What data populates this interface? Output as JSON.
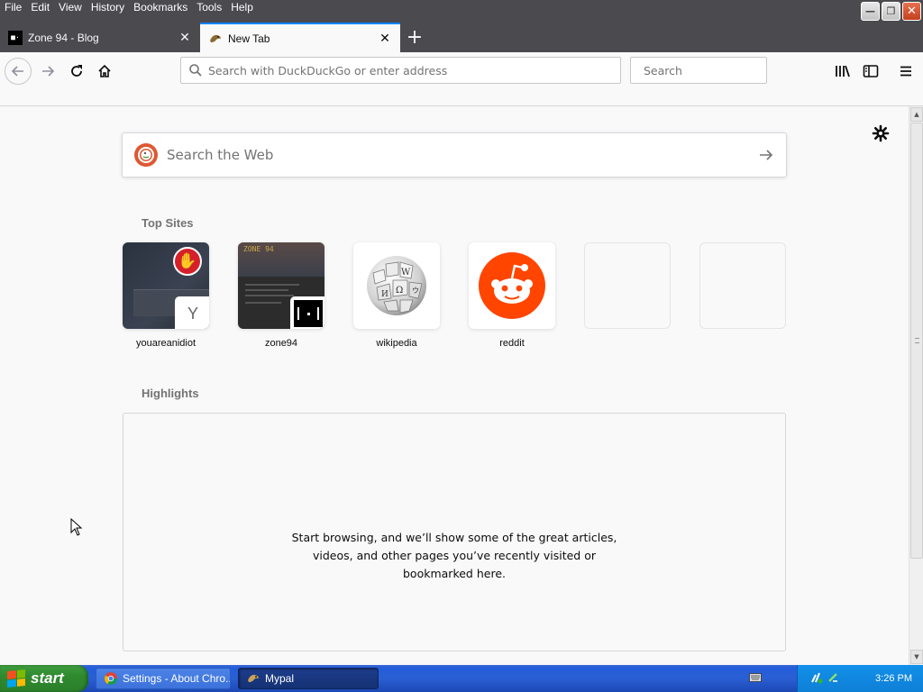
{
  "menu": {
    "items": [
      "File",
      "Edit",
      "View",
      "History",
      "Bookmarks",
      "Tools",
      "Help"
    ]
  },
  "tabs": [
    {
      "label": "Zone 94 - Blog",
      "favicon": "zone94-favicon",
      "active": false
    },
    {
      "label": "New Tab",
      "favicon": "mypal-favicon",
      "active": true
    }
  ],
  "navbar": {
    "url_placeholder": "Search with DuckDuckGo or enter address",
    "search_placeholder": "Search"
  },
  "newtab": {
    "websearch_placeholder": "Search the Web",
    "topsites_title": "Top Sites",
    "topsites": [
      {
        "label": "youareanidiot",
        "badge": "Y"
      },
      {
        "label": "zone94"
      },
      {
        "label": "wikipedia"
      },
      {
        "label": "reddit"
      },
      {
        "label": ""
      },
      {
        "label": ""
      }
    ],
    "highlights_title": "Highlights",
    "highlights_message": [
      "Start browsing, and we’ll show some of the great articles,",
      "videos, and other pages you’ve recently visited or",
      "bookmarked here."
    ]
  },
  "taskbar": {
    "start_label": "start",
    "tasks": [
      {
        "label": "Settings - About Chro...",
        "icon": "chrome-icon"
      },
      {
        "label": "Mypal",
        "icon": "mypal-icon",
        "active": true
      }
    ],
    "clock": "3:26 PM"
  },
  "colors": {
    "accent": "#0a84ff",
    "titlebar": "#4a4a4f",
    "reddit": "#ff4500",
    "duckduckgo": "#de5833",
    "taskbar": "#245edb",
    "start": "#3c9a3c"
  }
}
